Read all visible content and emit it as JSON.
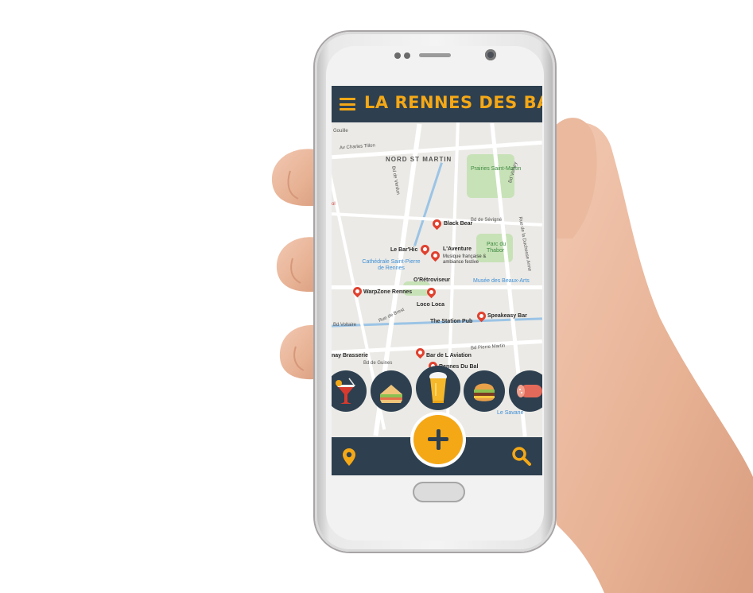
{
  "app": {
    "title": "LA RENNES DES BARS",
    "colors": {
      "header": "#2e4050",
      "accent": "#f5a816",
      "pin": "#e0412e"
    }
  },
  "map": {
    "areas": [
      "NORD ST MARTIN"
    ],
    "parks": [
      "Prairies Saint-Martin",
      "Parc du Thabor"
    ],
    "landmarks": [
      "Cathédrale Saint-Pierre de Rennes",
      "Musée des Beaux-Arts",
      "Le Savane"
    ],
    "streets": [
      "Av Charles Tillon",
      "Bd de Verdun",
      "Rue de Brest",
      "Bd Voltaire",
      "Bd de Guines",
      "Bd Pierre Martin",
      "Bd Volney",
      "Bd de Sévigné",
      "Rue de la Duchesse Anne",
      "Quai St-Cyr",
      "Bd d'Alma",
      "Rue de Dinan"
    ],
    "bars": [
      {
        "name": "Black Bear"
      },
      {
        "name": "Le Bar'Hic"
      },
      {
        "name": "L'Aventure",
        "note": "Musique française & ambiance festive"
      },
      {
        "name": "O'Rétroviseur"
      },
      {
        "name": "WarpZone Rennes"
      },
      {
        "name": "Loco Loca"
      },
      {
        "name": "The Station Pub"
      },
      {
        "name": "Speakeasy Bar"
      },
      {
        "name": "Bar de L Aviation"
      },
      {
        "name": "Rennes Du Bal"
      },
      {
        "name": "nay Brasserie"
      }
    ],
    "partial_labels": [
      "Gouille",
      "Bd de Verdun",
      "Sillon",
      "ol"
    ]
  },
  "categories": [
    {
      "icon": "cocktail-icon"
    },
    {
      "icon": "sandwich-icon"
    },
    {
      "icon": "beer-icon"
    },
    {
      "icon": "burger-icon"
    },
    {
      "icon": "charcuterie-icon"
    }
  ],
  "bottom_bar": {
    "left_icon": "location-pin-icon",
    "center_icon": "add-icon",
    "right_icon": "search-icon"
  }
}
